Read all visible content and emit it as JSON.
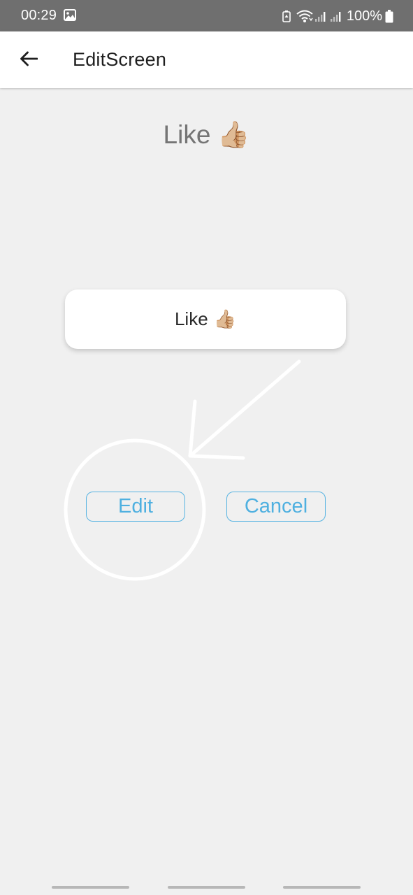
{
  "status_bar": {
    "time": "00:29",
    "battery_percent": "100%",
    "icons": [
      "gallery-icon",
      "battery-saver-icon",
      "wifi-icon",
      "cell-signal-icon",
      "cell-signal-icon",
      "battery-icon"
    ]
  },
  "app_bar": {
    "title": "EditScreen",
    "back_icon": "arrow-left-icon"
  },
  "content": {
    "reaction_title_text": "Like",
    "reaction_title_emoji": "👍🏼",
    "card_text": "Like",
    "card_emoji": "👍🏼"
  },
  "buttons": {
    "edit_label": "Edit",
    "cancel_label": "Cancel"
  },
  "colors": {
    "status_bar": "#6f6f6f",
    "app_bar": "#ffffff",
    "background": "#f0f0f0",
    "accent": "#58b4e2",
    "annotation": "#ffffff"
  },
  "annotation": {
    "type": "circle-with-arrow",
    "target": "edit-button"
  }
}
